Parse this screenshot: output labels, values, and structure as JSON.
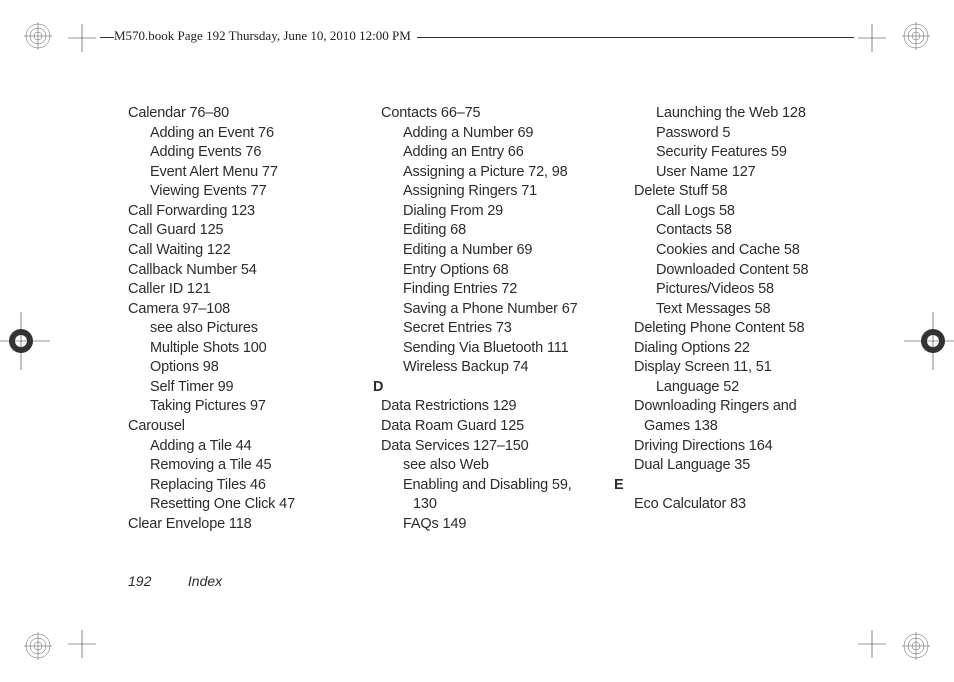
{
  "header": "M570.book  Page 192  Thursday, June 10, 2010  12:00 PM",
  "footer": {
    "page": "192",
    "label": "Index"
  },
  "col1": [
    {
      "t": "Calendar 76–80",
      "c": "entry"
    },
    {
      "t": "Adding an Event 76",
      "c": "sub"
    },
    {
      "t": "Adding Events 76",
      "c": "sub"
    },
    {
      "t": "Event Alert Menu 77",
      "c": "sub"
    },
    {
      "t": "Viewing Events 77",
      "c": "sub"
    },
    {
      "t": "Call Forwarding 123",
      "c": "entry"
    },
    {
      "t": "Call Guard 125",
      "c": "entry"
    },
    {
      "t": "Call Waiting 122",
      "c": "entry"
    },
    {
      "t": "Callback Number 54",
      "c": "entry"
    },
    {
      "t": "Caller ID 121",
      "c": "entry"
    },
    {
      "t": "Camera 97–108",
      "c": "entry"
    },
    {
      "t": "see also Pictures",
      "c": "sub"
    },
    {
      "t": "Multiple Shots 100",
      "c": "sub"
    },
    {
      "t": "Options 98",
      "c": "sub"
    },
    {
      "t": "Self Timer 99",
      "c": "sub"
    },
    {
      "t": "Taking Pictures 97",
      "c": "sub"
    },
    {
      "t": "Carousel",
      "c": "entry"
    },
    {
      "t": "Adding a Tile 44",
      "c": "sub"
    },
    {
      "t": "Removing a Tile 45",
      "c": "sub"
    },
    {
      "t": "Replacing Tiles 46",
      "c": "sub"
    },
    {
      "t": "Resetting One Click 47",
      "c": "sub"
    },
    {
      "t": "Clear Envelope 118",
      "c": "entry"
    }
  ],
  "col2": [
    {
      "t": "Contacts 66–75",
      "c": "entry"
    },
    {
      "t": "Adding a Number 69",
      "c": "sub"
    },
    {
      "t": "Adding an Entry 66",
      "c": "sub"
    },
    {
      "t": "Assigning a Picture 72, 98",
      "c": "sub"
    },
    {
      "t": "Assigning Ringers 71",
      "c": "sub"
    },
    {
      "t": "Dialing From 29",
      "c": "sub"
    },
    {
      "t": "Editing 68",
      "c": "sub"
    },
    {
      "t": "Editing a Number 69",
      "c": "sub"
    },
    {
      "t": "Entry Options 68",
      "c": "sub"
    },
    {
      "t": "Finding Entries 72",
      "c": "sub"
    },
    {
      "t": "Saving a Phone Number 67",
      "c": "sub"
    },
    {
      "t": "Secret Entries 73",
      "c": "sub"
    },
    {
      "t": "Sending Via Bluetooth 111",
      "c": "sub"
    },
    {
      "t": "Wireless Backup 74",
      "c": "sub"
    },
    {
      "t": "D",
      "c": "sec-letter"
    },
    {
      "t": "Data Restrictions 129",
      "c": "entry"
    },
    {
      "t": "Data Roam Guard 125",
      "c": "entry"
    },
    {
      "t": "Data Services 127–150",
      "c": "entry"
    },
    {
      "t": "see also Web",
      "c": "sub"
    },
    {
      "t": "Enabling and Disabling 59,",
      "c": "sub"
    },
    {
      "t": "130",
      "c": "sub2"
    },
    {
      "t": "FAQs 149",
      "c": "sub"
    }
  ],
  "col3": [
    {
      "t": "Launching the Web 128",
      "c": "sub"
    },
    {
      "t": "Password 5",
      "c": "sub"
    },
    {
      "t": "Security Features 59",
      "c": "sub"
    },
    {
      "t": "User Name 127",
      "c": "sub"
    },
    {
      "t": "Delete Stuff 58",
      "c": "entry"
    },
    {
      "t": "Call Logs 58",
      "c": "sub"
    },
    {
      "t": "Contacts 58",
      "c": "sub"
    },
    {
      "t": "Cookies and Cache 58",
      "c": "sub"
    },
    {
      "t": "Downloaded Content 58",
      "c": "sub"
    },
    {
      "t": "Pictures/Videos 58",
      "c": "sub"
    },
    {
      "t": "Text Messages 58",
      "c": "sub"
    },
    {
      "t": "Deleting Phone Content 58",
      "c": "entry"
    },
    {
      "t": "Dialing Options 22",
      "c": "entry"
    },
    {
      "t": "Display Screen 11, 51",
      "c": "entry"
    },
    {
      "t": "Language 52",
      "c": "sub"
    },
    {
      "t": "Downloading Ringers and",
      "c": "entry"
    },
    {
      "t": "Games 138",
      "c": "entry",
      "pad": "10"
    },
    {
      "t": "Driving Directions 164",
      "c": "entry"
    },
    {
      "t": "Dual Language 35",
      "c": "entry"
    },
    {
      "t": "E",
      "c": "sec-letter"
    },
    {
      "t": "Eco Calculator 83",
      "c": "entry"
    }
  ]
}
